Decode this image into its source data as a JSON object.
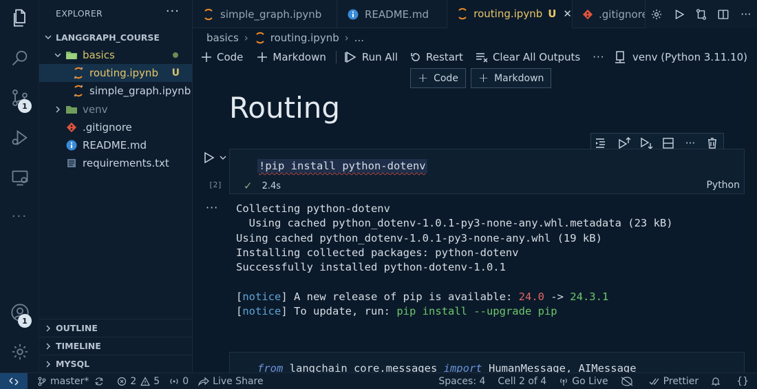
{
  "explorer": {
    "title": "EXPLORER",
    "more": "···",
    "workspace": "LANGGRAPH_COURSE",
    "tree": [
      {
        "label": "basics",
        "kind": "folder-open",
        "decoration": "dot"
      },
      {
        "label": "routing.ipynb",
        "kind": "notebook",
        "decoration": "U"
      },
      {
        "label": "simple_graph.ipynb",
        "kind": "notebook",
        "decoration": ""
      },
      {
        "label": "venv",
        "kind": "folder",
        "decoration": ""
      },
      {
        "label": ".gitignore",
        "kind": "git",
        "decoration": ""
      },
      {
        "label": "README.md",
        "kind": "info",
        "decoration": ""
      },
      {
        "label": "requirements.txt",
        "kind": "text",
        "decoration": ""
      }
    ],
    "panels": [
      "OUTLINE",
      "TIMELINE",
      "MYSQL"
    ]
  },
  "activity": {
    "source_control_badge": "1",
    "accounts_badge": "1"
  },
  "tabs": [
    {
      "label": "simple_graph.ipynb",
      "icon": "notebook-icon",
      "active": false
    },
    {
      "label": "README.md",
      "icon": "info-icon",
      "active": false
    },
    {
      "label": "routing.ipynb",
      "icon": "notebook-icon",
      "active": true,
      "decoration": "U",
      "close": "✕"
    },
    {
      "label": ".gitignore",
      "icon": "git-icon",
      "active": false
    }
  ],
  "breadcrumb": {
    "folder": "basics",
    "file": "routing.ipynb",
    "more": "..."
  },
  "toolbar": {
    "code": "Code",
    "markdown": "Markdown",
    "run_all": "Run All",
    "restart": "Restart",
    "clear_outputs": "Clear All Outputs",
    "more": "···",
    "kernel": "venv (Python 3.11.10)"
  },
  "insert": {
    "code": "Code",
    "markdown": "Markdown"
  },
  "notebook": {
    "heading": "Routing",
    "cell": {
      "code": "!pip install python-dotenv",
      "execution_count": "[2]",
      "duration": "2.4s",
      "language": "Python"
    },
    "output": {
      "line1": "Collecting python-dotenv",
      "line2": "  Using cached python_dotenv-1.0.1-py3-none-any.whl.metadata (23 kB)",
      "line3": "Using cached python_dotenv-1.0.1-py3-none-any.whl (19 kB)",
      "line4": "Installing collected packages: python-dotenv",
      "line5": "Successfully installed python-dotenv-1.0.1",
      "notice_tag": "notice",
      "notice1_text": " A new release of pip is available: ",
      "old_version": "24.0",
      "arrow": " -> ",
      "new_version": "24.3.1",
      "notice2_text": " To update, run: ",
      "upgrade_cmd": "pip install --upgrade pip"
    },
    "next_cell": {
      "kw_from": "from",
      "module": " langchain_core.messages ",
      "kw_import": "import",
      "names": " HumanMessage, AIMessage"
    }
  },
  "statusbar": {
    "branch": "master*",
    "errors": "2",
    "warnings": "5",
    "ports": "0",
    "live_share": "Live Share",
    "spaces": "Spaces: 4",
    "cell": "Cell 2 of 4",
    "go_live": "Go Live",
    "prettier": "Prettier",
    "braces": "{}"
  },
  "colors": {
    "background": "#0b1a2a",
    "accent_gitU": "#e7c66a",
    "notebook_orange": "#f08a24",
    "info_blue": "#3a8bd8",
    "git_red": "#e0533a"
  }
}
